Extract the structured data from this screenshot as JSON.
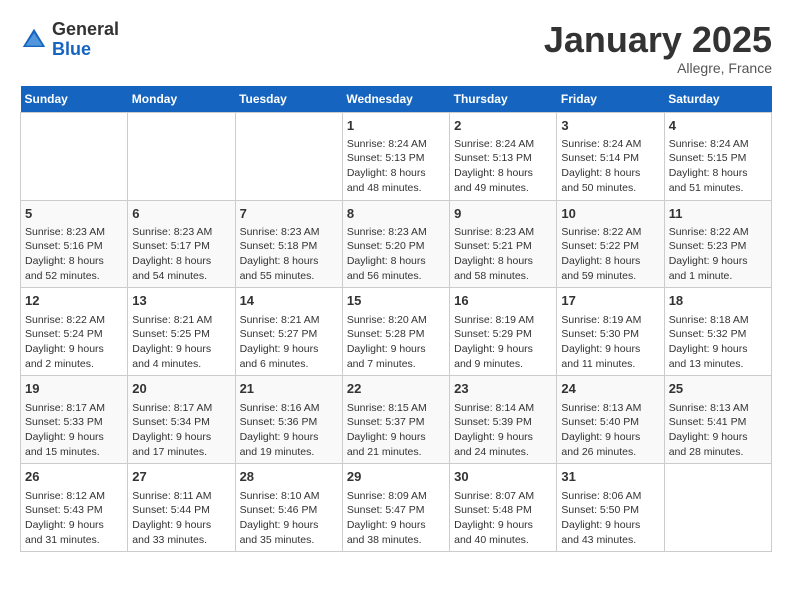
{
  "logo": {
    "general": "General",
    "blue": "Blue"
  },
  "title": "January 2025",
  "subtitle": "Allegre, France",
  "days_of_week": [
    "Sunday",
    "Monday",
    "Tuesday",
    "Wednesday",
    "Thursday",
    "Friday",
    "Saturday"
  ],
  "weeks": [
    [
      {
        "day": "",
        "info": ""
      },
      {
        "day": "",
        "info": ""
      },
      {
        "day": "",
        "info": ""
      },
      {
        "day": "1",
        "info": "Sunrise: 8:24 AM\nSunset: 5:13 PM\nDaylight: 8 hours and 48 minutes."
      },
      {
        "day": "2",
        "info": "Sunrise: 8:24 AM\nSunset: 5:13 PM\nDaylight: 8 hours and 49 minutes."
      },
      {
        "day": "3",
        "info": "Sunrise: 8:24 AM\nSunset: 5:14 PM\nDaylight: 8 hours and 50 minutes."
      },
      {
        "day": "4",
        "info": "Sunrise: 8:24 AM\nSunset: 5:15 PM\nDaylight: 8 hours and 51 minutes."
      }
    ],
    [
      {
        "day": "5",
        "info": "Sunrise: 8:23 AM\nSunset: 5:16 PM\nDaylight: 8 hours and 52 minutes."
      },
      {
        "day": "6",
        "info": "Sunrise: 8:23 AM\nSunset: 5:17 PM\nDaylight: 8 hours and 54 minutes."
      },
      {
        "day": "7",
        "info": "Sunrise: 8:23 AM\nSunset: 5:18 PM\nDaylight: 8 hours and 55 minutes."
      },
      {
        "day": "8",
        "info": "Sunrise: 8:23 AM\nSunset: 5:20 PM\nDaylight: 8 hours and 56 minutes."
      },
      {
        "day": "9",
        "info": "Sunrise: 8:23 AM\nSunset: 5:21 PM\nDaylight: 8 hours and 58 minutes."
      },
      {
        "day": "10",
        "info": "Sunrise: 8:22 AM\nSunset: 5:22 PM\nDaylight: 8 hours and 59 minutes."
      },
      {
        "day": "11",
        "info": "Sunrise: 8:22 AM\nSunset: 5:23 PM\nDaylight: 9 hours and 1 minute."
      }
    ],
    [
      {
        "day": "12",
        "info": "Sunrise: 8:22 AM\nSunset: 5:24 PM\nDaylight: 9 hours and 2 minutes."
      },
      {
        "day": "13",
        "info": "Sunrise: 8:21 AM\nSunset: 5:25 PM\nDaylight: 9 hours and 4 minutes."
      },
      {
        "day": "14",
        "info": "Sunrise: 8:21 AM\nSunset: 5:27 PM\nDaylight: 9 hours and 6 minutes."
      },
      {
        "day": "15",
        "info": "Sunrise: 8:20 AM\nSunset: 5:28 PM\nDaylight: 9 hours and 7 minutes."
      },
      {
        "day": "16",
        "info": "Sunrise: 8:19 AM\nSunset: 5:29 PM\nDaylight: 9 hours and 9 minutes."
      },
      {
        "day": "17",
        "info": "Sunrise: 8:19 AM\nSunset: 5:30 PM\nDaylight: 9 hours and 11 minutes."
      },
      {
        "day": "18",
        "info": "Sunrise: 8:18 AM\nSunset: 5:32 PM\nDaylight: 9 hours and 13 minutes."
      }
    ],
    [
      {
        "day": "19",
        "info": "Sunrise: 8:17 AM\nSunset: 5:33 PM\nDaylight: 9 hours and 15 minutes."
      },
      {
        "day": "20",
        "info": "Sunrise: 8:17 AM\nSunset: 5:34 PM\nDaylight: 9 hours and 17 minutes."
      },
      {
        "day": "21",
        "info": "Sunrise: 8:16 AM\nSunset: 5:36 PM\nDaylight: 9 hours and 19 minutes."
      },
      {
        "day": "22",
        "info": "Sunrise: 8:15 AM\nSunset: 5:37 PM\nDaylight: 9 hours and 21 minutes."
      },
      {
        "day": "23",
        "info": "Sunrise: 8:14 AM\nSunset: 5:39 PM\nDaylight: 9 hours and 24 minutes."
      },
      {
        "day": "24",
        "info": "Sunrise: 8:13 AM\nSunset: 5:40 PM\nDaylight: 9 hours and 26 minutes."
      },
      {
        "day": "25",
        "info": "Sunrise: 8:13 AM\nSunset: 5:41 PM\nDaylight: 9 hours and 28 minutes."
      }
    ],
    [
      {
        "day": "26",
        "info": "Sunrise: 8:12 AM\nSunset: 5:43 PM\nDaylight: 9 hours and 31 minutes."
      },
      {
        "day": "27",
        "info": "Sunrise: 8:11 AM\nSunset: 5:44 PM\nDaylight: 9 hours and 33 minutes."
      },
      {
        "day": "28",
        "info": "Sunrise: 8:10 AM\nSunset: 5:46 PM\nDaylight: 9 hours and 35 minutes."
      },
      {
        "day": "29",
        "info": "Sunrise: 8:09 AM\nSunset: 5:47 PM\nDaylight: 9 hours and 38 minutes."
      },
      {
        "day": "30",
        "info": "Sunrise: 8:07 AM\nSunset: 5:48 PM\nDaylight: 9 hours and 40 minutes."
      },
      {
        "day": "31",
        "info": "Sunrise: 8:06 AM\nSunset: 5:50 PM\nDaylight: 9 hours and 43 minutes."
      },
      {
        "day": "",
        "info": ""
      }
    ]
  ]
}
